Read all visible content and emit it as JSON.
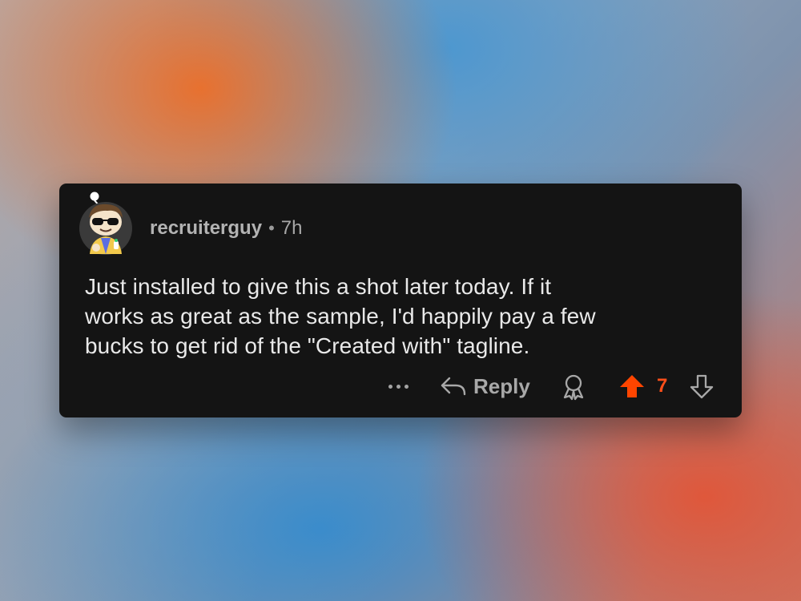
{
  "comment": {
    "username": "recruiterguy",
    "separator": "•",
    "time": "7h",
    "text": "Just installed to give this a shot later today.  If it\nworks as great as the sample, I'd happily pay a few\nbucks to get rid of the \"Created with\" tagline."
  },
  "actions": {
    "reply_label": "Reply",
    "vote_count": "7",
    "more_icon": "more-horizontal-icon",
    "reply_icon": "reply-arrow-icon",
    "award_icon": "award-ribbon-icon",
    "upvote_icon": "upvote-arrow-icon",
    "downvote_icon": "downvote-arrow-icon"
  },
  "colors": {
    "card_background": "#141414",
    "upvote_active": "#ff4500",
    "text_primary": "#e9e9e9",
    "text_secondary": "#a8a8a8"
  }
}
